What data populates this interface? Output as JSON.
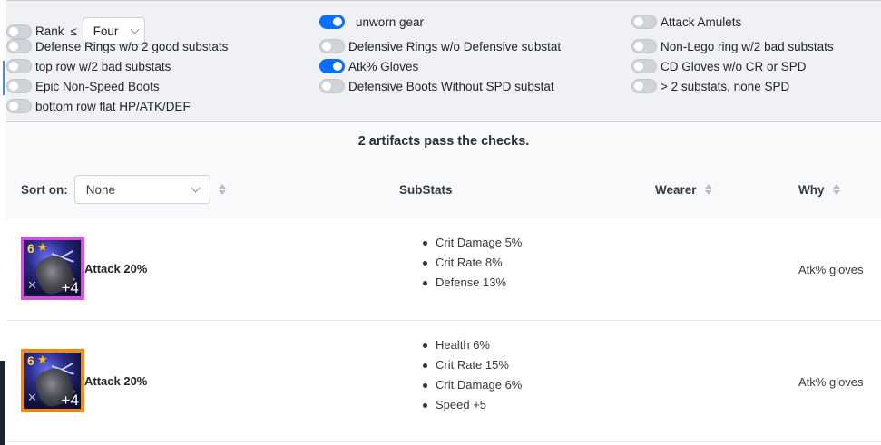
{
  "filters": {
    "rank": {
      "label": "Rank",
      "symbol": "≤",
      "value": "Four",
      "on": false
    },
    "column1": [
      {
        "label": "Defense Rings w/o 2 good substats",
        "on": false
      },
      {
        "label": "top row w/2 bad substats",
        "on": false
      },
      {
        "label": "Epic Non-Speed Boots",
        "on": false
      },
      {
        "label": "bottom row flat HP/ATK/DEF",
        "on": false
      }
    ],
    "column2": [
      {
        "label": "unworn gear",
        "on": true
      },
      {
        "label": "Defensive Rings w/o Defensive substat",
        "on": false
      },
      {
        "label": "Atk% Gloves",
        "on": true
      },
      {
        "label": "Defensive Boots Without SPD substat",
        "on": false
      }
    ],
    "column3": [
      {
        "label": "Attack Amulets",
        "on": false
      },
      {
        "label": "Non-Lego ring w/2 bad substats",
        "on": false
      },
      {
        "label": "CD Gloves w/o CR or SPD",
        "on": false
      },
      {
        "label": "> 2 substats, none SPD",
        "on": false
      }
    ]
  },
  "summary": "2 artifacts pass the checks.",
  "table": {
    "sort_label": "Sort on:",
    "sort_value": "None",
    "headers": {
      "substats": "SubStats",
      "wearer": "Wearer",
      "why": "Why"
    }
  },
  "rows": [
    {
      "rank": "6",
      "level": "+4",
      "border_color": "#d24fe0",
      "mainstat": "Attack 20%",
      "substats": [
        "Crit Damage 5%",
        "Crit Rate 8%",
        "Defense 13%"
      ],
      "wearer": "",
      "why": "Atk% gloves"
    },
    {
      "rank": "6",
      "level": "+4",
      "border_color": "#ef8a10",
      "mainstat": "Attack 20%",
      "substats": [
        "Health 6%",
        "Crit Rate 15%",
        "Crit Damage 6%",
        "Speed +5"
      ],
      "wearer": "",
      "why": "Atk% gloves"
    }
  ],
  "icons": {
    "toggle": "toggle-switch",
    "chevron": "chevron-down-icon",
    "sort": "sort-icon",
    "star": "star-icon",
    "set": "set-icon"
  },
  "colors": {
    "toggle_on": "#0d6efd",
    "toggle_off": "#d0d3d8",
    "filter_bg": "#f0f1f4"
  }
}
